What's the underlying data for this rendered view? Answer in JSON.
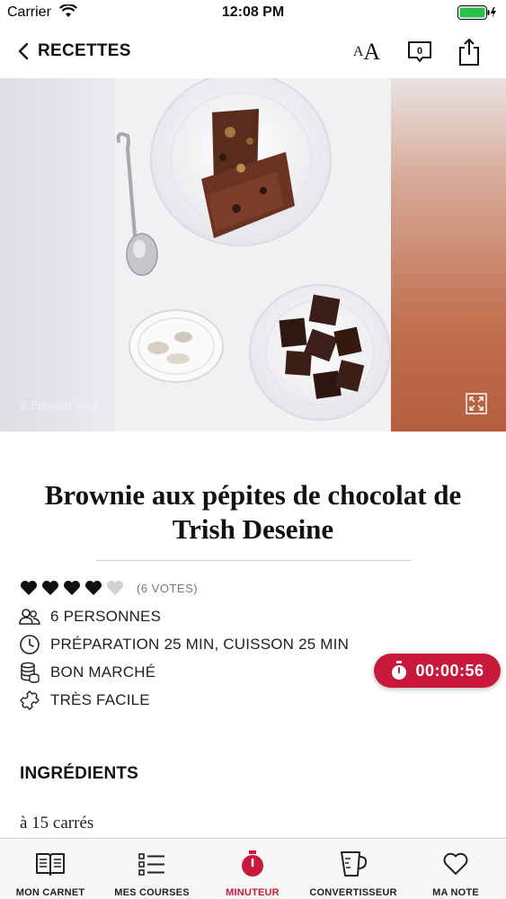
{
  "status_bar": {
    "carrier": "Carrier",
    "time": "12:08 PM"
  },
  "nav": {
    "back_label": "RECETTES",
    "font_size_small": "A",
    "font_size_large": "A",
    "comment_count": "0"
  },
  "hero": {
    "photo_credit": "© Edouard Sicot"
  },
  "recipe": {
    "title": "Brownie aux pépites de chocolat de Trish Deseine",
    "rating": 4,
    "rating_max": 5,
    "votes": "(6 VOTES)",
    "servings": "6 PERSONNES",
    "time": "PRÉPARATION 25 MIN, CUISSON 25 MIN",
    "cost": "BON MARCHÉ",
    "difficulty": "TRÈS FACILE"
  },
  "timer": {
    "value": "00:00:56",
    "color": "#c8193a"
  },
  "ingredients": {
    "title": "INGRÉDIENTS",
    "portion": "à 15 carrés"
  },
  "tabs": [
    {
      "label": "MON CARNET",
      "icon": "book-icon",
      "active": false
    },
    {
      "label": "MES COURSES",
      "icon": "list-icon",
      "active": false
    },
    {
      "label": "MINUTEUR",
      "icon": "stopwatch-icon",
      "active": true
    },
    {
      "label": "CONVERTISSEUR",
      "icon": "measuring-cup-icon",
      "active": false
    },
    {
      "label": "MA NOTE",
      "icon": "heart-icon",
      "active": false
    }
  ]
}
